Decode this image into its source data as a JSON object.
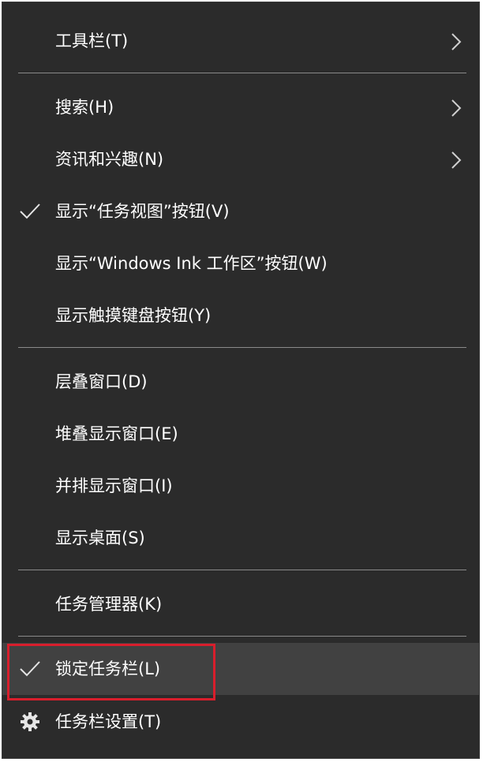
{
  "menu": {
    "items": [
      {
        "label": "工具栏(T)",
        "checked": false,
        "submenu": true
      },
      {
        "label": "搜索(H)",
        "checked": false,
        "submenu": true
      },
      {
        "label": "资讯和兴趣(N)",
        "checked": false,
        "submenu": true
      },
      {
        "label": "显示“任务视图”按钮(V)",
        "checked": true,
        "submenu": false
      },
      {
        "label": "显示“Windows Ink 工作区”按钮(W)",
        "checked": false,
        "submenu": false
      },
      {
        "label": "显示触摸键盘按钮(Y)",
        "checked": false,
        "submenu": false
      },
      {
        "label": "层叠窗口(D)",
        "checked": false,
        "submenu": false
      },
      {
        "label": "堆叠显示窗口(E)",
        "checked": false,
        "submenu": false
      },
      {
        "label": "并排显示窗口(I)",
        "checked": false,
        "submenu": false
      },
      {
        "label": "显示桌面(S)",
        "checked": false,
        "submenu": false
      },
      {
        "label": "任务管理器(K)",
        "checked": false,
        "submenu": false
      },
      {
        "label": "锁定任务栏(L)",
        "checked": true,
        "submenu": false,
        "hovered": true
      },
      {
        "label": "任务栏设置(T)",
        "checked": false,
        "submenu": false,
        "icon": "gear-icon"
      }
    ]
  },
  "colors": {
    "menu_background": "#2b2b2b",
    "hover_background": "#414141",
    "text": "#ffffff",
    "separator": "#8a8a8a",
    "annotation_box": "#d81e2c"
  }
}
